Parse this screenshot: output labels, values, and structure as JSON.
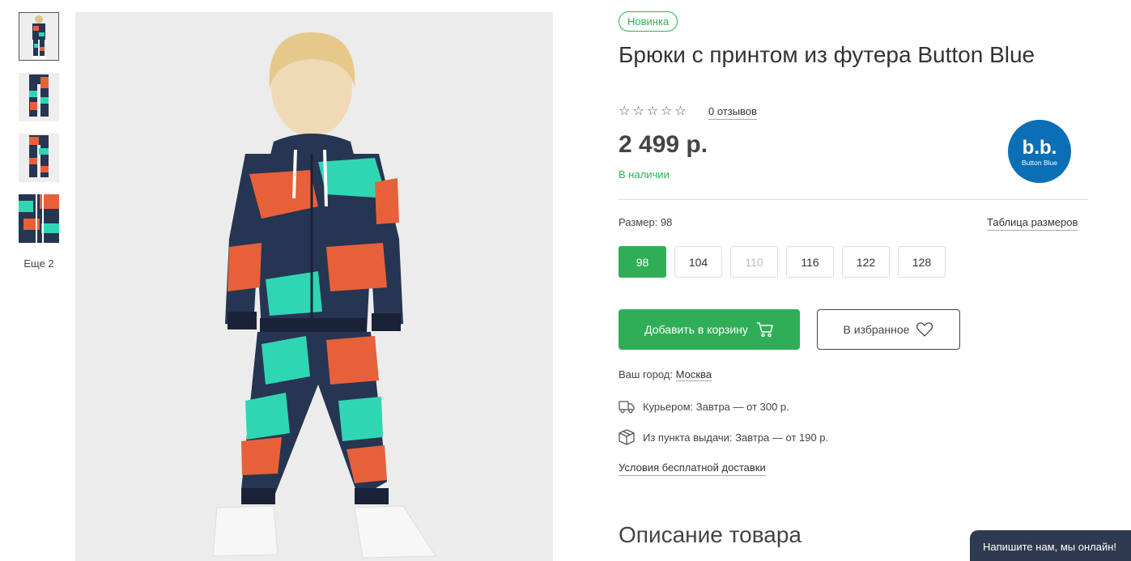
{
  "gallery": {
    "thumbnails": [
      "thumb-1",
      "thumb-2",
      "thumb-3",
      "thumb-4"
    ],
    "more_label": "Еще 2"
  },
  "product": {
    "badge": "Новинка",
    "title": "Брюки с принтом из футера Button Blue",
    "stars": [
      "☆",
      "☆",
      "☆",
      "☆",
      "☆"
    ],
    "reviews": "0 отзывов",
    "price": "2 499 р.",
    "stock": "В наличии",
    "brand_logo_text_big": "b.b.",
    "brand_logo_text_small": "Button Blue"
  },
  "sizes": {
    "label": "Размер: 98",
    "table_link": "Таблица размеров",
    "options": [
      "98",
      "104",
      "110",
      "116",
      "122",
      "128"
    ],
    "selected": "98"
  },
  "actions": {
    "cart": "Добавить в корзину",
    "favorite": "В избранное"
  },
  "delivery": {
    "city_label": "Ваш город:",
    "city": "Москва",
    "courier": "Курьером: Завтра — от 300 р.",
    "pickup": "Из пункта выдачи: Завтра — от 190 р.",
    "free_link": "Условия бесплатной доставки"
  },
  "description_title": "Описание товара",
  "chat": "Напишите нам, мы онлайн!",
  "colors": {
    "accent": "#2fae57",
    "navy": "#263552",
    "orange": "#e8603a",
    "teal": "#2fd6b4",
    "brand_blue": "#0a6fb5",
    "chat_bg": "#2e3a4f"
  }
}
